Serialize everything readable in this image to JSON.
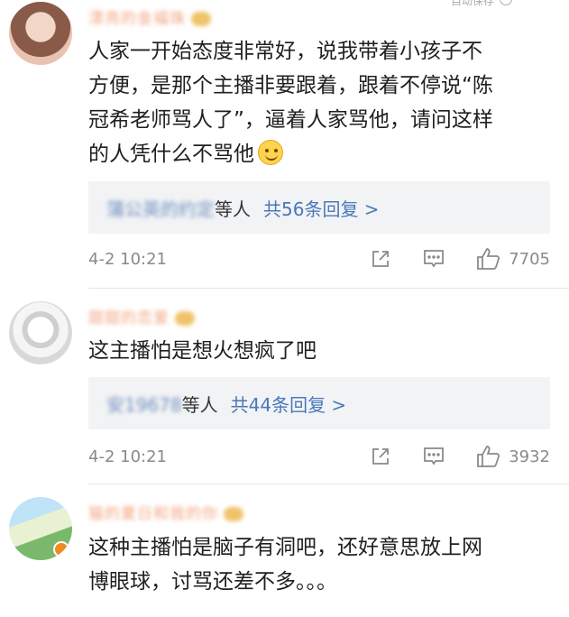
{
  "topbar": {
    "label": "自动保存"
  },
  "comments": [
    {
      "username": "漂亮的金福珠",
      "text_lines": [
        "人家一开始态度非常好，说我带着小孩子不",
        "方便，是那个主播非要跟着，跟着不停说“陈",
        "冠希老师骂人了”，逼着人家骂他，请问这样",
        "的人凭什么不骂他"
      ],
      "emoji": "smiley-icon",
      "reply": {
        "names": "蒲公英的约定",
        "suffix": "等人",
        "count_label": "共56条回复 >"
      },
      "time": "4-2 10:21",
      "likes": "7705"
    },
    {
      "username": "甜甜的恋爱",
      "text_lines": [
        "这主播怕是想火想疯了吧"
      ],
      "reply": {
        "names": "安19678",
        "suffix": "等人",
        "count_label": "共44条回复 >"
      },
      "time": "4-2 10:21",
      "likes": "3932"
    },
    {
      "username": "猫的夏日和我的你",
      "text_lines": [
        "这种主播怕是脑子有洞吧，还好意思放上网",
        "博眼球，讨骂还差不多。。。"
      ]
    }
  ],
  "colors": {
    "link_blue": "#4a78b8",
    "username_orange": "#f3a37f",
    "reply_bg": "#f2f3f5",
    "meta_gray": "#8a8a8a"
  },
  "icons": {
    "share": "share-icon",
    "comment": "comment-icon",
    "like": "thumbs-up-icon"
  }
}
